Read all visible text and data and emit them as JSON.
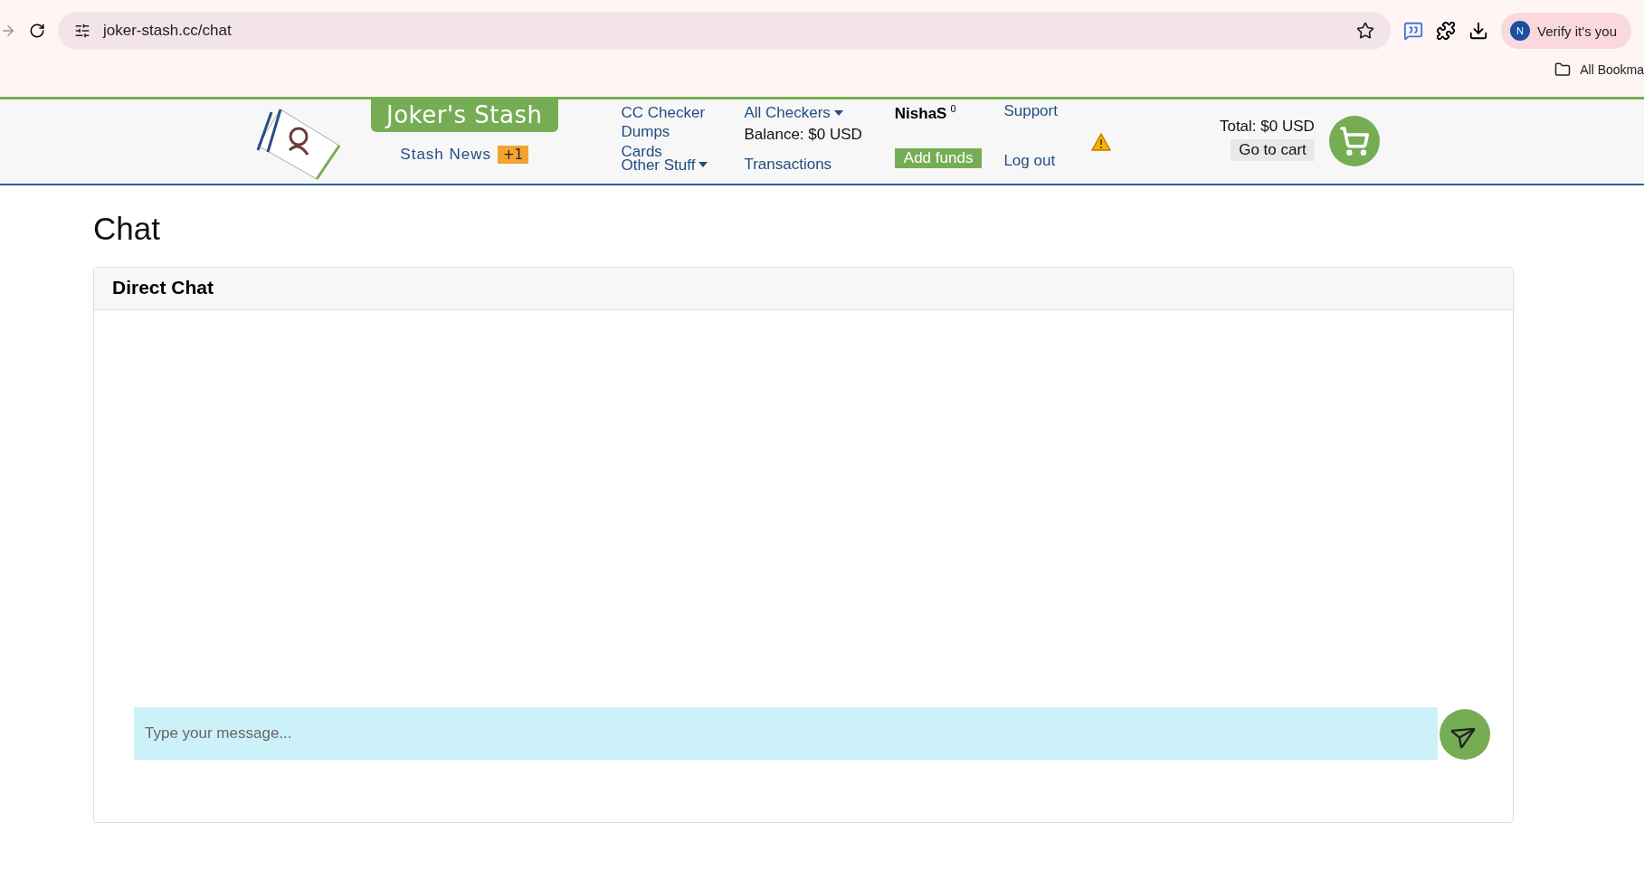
{
  "browser": {
    "url": "joker-stash.cc/chat",
    "profile_button": "Verify it's you",
    "profile_initial": "N",
    "bookmarks": "All Bookma"
  },
  "header": {
    "brand": "Joker's Stash",
    "news": {
      "label": "Stash News",
      "badge": "+1"
    },
    "menu_1": [
      {
        "label": "CC Checker",
        "dropdown": false
      },
      {
        "label": "Dumps",
        "dropdown": false
      },
      {
        "label": "Cards",
        "dropdown": false
      },
      {
        "label": "Other Stuff",
        "dropdown": true
      }
    ],
    "all_checkers": "All Checkers",
    "balance": "Balance: $0 USD",
    "transactions": "Transactions",
    "user": {
      "name": "NishaS",
      "count": "0"
    },
    "add_funds": "Add funds",
    "support": "Support",
    "logout": "Log out",
    "total": "Total: $0 USD",
    "go_to_cart": "Go to cart"
  },
  "page": {
    "title": "Chat",
    "card_title": "Direct Chat",
    "message_placeholder": "Type your message..."
  }
}
